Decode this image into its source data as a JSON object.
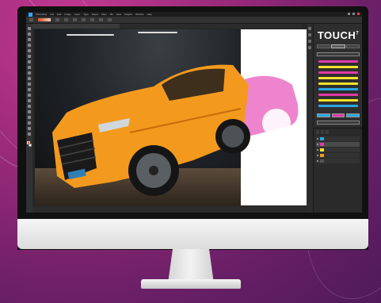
{
  "app": {
    "name": "Photoshop",
    "menu": [
      "File",
      "Edit",
      "Image",
      "Layer",
      "Type",
      "Select",
      "Filter",
      "3D",
      "View",
      "Plugins",
      "Window",
      "Help"
    ]
  },
  "tools": [
    "move-tool",
    "marquee-tool",
    "lasso-tool",
    "magic-wand-tool",
    "crop-tool",
    "eyedropper-tool",
    "healing-tool",
    "brush-tool",
    "clone-stamp-tool",
    "history-brush-tool",
    "eraser-tool",
    "gradient-tool",
    "blur-tool",
    "dodge-tool",
    "pen-tool",
    "type-tool",
    "path-selection-tool",
    "shape-tool",
    "hand-tool",
    "zoom-tool"
  ],
  "colors": {
    "foreground": "#e34d24",
    "background": "#ffffff",
    "car_body": "#f39a1e",
    "car_overlay": "#ec6fc6",
    "panel_dark": "#2e2e2e"
  },
  "touch_panel": {
    "logo_text": "TOUCH",
    "logo_sup": "7",
    "swatches": [
      "#e13aa8",
      "#f5e12b",
      "#e13aa8",
      "#f5e12b",
      "#f5e12b",
      "#2aa7e4",
      "#e13aa8",
      "#f5e12b",
      "#2aa7e4"
    ],
    "grid_swatches": [
      "#2aa7e4",
      "#e13aa8",
      "#2aa7e4"
    ]
  },
  "layers_panel": {
    "layers": [
      {
        "thumb": "#2aa7e4",
        "selected": false
      },
      {
        "thumb": "#e13aa8",
        "selected": true
      },
      {
        "thumb": "#f5e12b",
        "selected": false
      },
      {
        "thumb": "#f39a1e",
        "selected": false
      },
      {
        "thumb": "#555555",
        "selected": false
      }
    ]
  },
  "icons": [
    "photoshop-logo-icon",
    "eye-icon",
    "gradient-swatch-icon",
    "window-close-icon"
  ]
}
